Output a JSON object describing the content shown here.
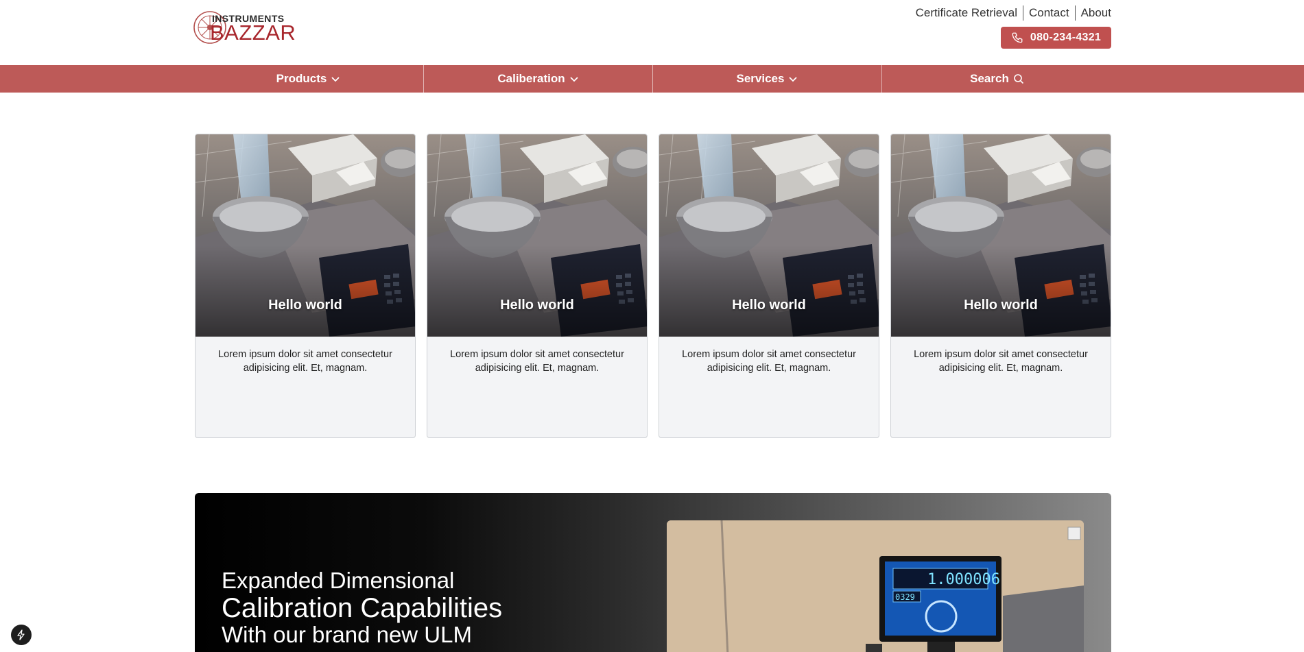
{
  "brand": {
    "top": "INSTRUMENTS",
    "main": "BAZZAR",
    "accent": "#a8262c"
  },
  "toplinks": [
    {
      "label": "Certificate Retrieval"
    },
    {
      "label": "Contact"
    },
    {
      "label": "About"
    }
  ],
  "phone": {
    "number": "080-234-4321",
    "icon": "phone-icon",
    "color": "#c0504f"
  },
  "nav": {
    "color": "#bd5a58",
    "items": [
      {
        "label": "Products",
        "icon": "chevron-down-icon"
      },
      {
        "label": "Caliberation",
        "icon": "chevron-down-icon"
      },
      {
        "label": "Services",
        "icon": "chevron-down-icon"
      },
      {
        "label": "Search",
        "icon": "search-icon"
      }
    ]
  },
  "cards": [
    {
      "title": "Hello world",
      "text": "Lorem ipsum dolor sit amet consectetur adipisicing elit. Et, magnam."
    },
    {
      "title": "Hello world",
      "text": "Lorem ipsum dolor sit amet consectetur adipisicing elit. Et, magnam."
    },
    {
      "title": "Hello world",
      "text": "Lorem ipsum dolor sit amet consectetur adipisicing elit. Et, magnam."
    },
    {
      "title": "Hello world",
      "text": "Lorem ipsum dolor sit amet consectetur adipisicing elit. Et, magnam."
    }
  ],
  "promo": {
    "line1": "Expanded Dimensional",
    "line2": "Calibration Capabilities",
    "line3": "With our brand new ULM",
    "display_reading": "1.000006",
    "display_sub": "0329"
  },
  "floating_button": {
    "icon": "bolt-icon"
  }
}
